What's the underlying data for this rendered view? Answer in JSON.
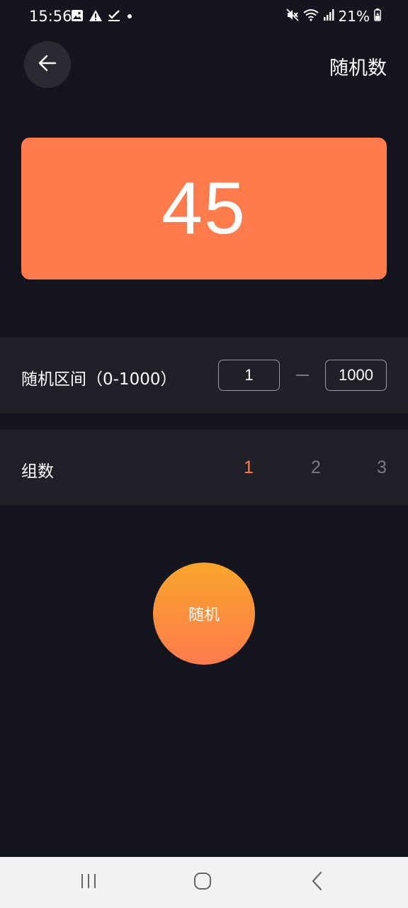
{
  "status_bar": {
    "time": "15:56",
    "battery_percent": "21%",
    "left_icons": [
      "image-icon",
      "warning-icon",
      "check-icon",
      "dot-icon"
    ],
    "right_icons": [
      "mute-icon",
      "wifi-icon",
      "signal-icon",
      "battery-charging-icon"
    ]
  },
  "header": {
    "back_icon": "arrow-left-icon",
    "title": "随机数"
  },
  "result": {
    "value": "45",
    "color": "#ff7b4c"
  },
  "range": {
    "label": "随机区间（0-1000）",
    "min_value": "1",
    "max_value": "1000"
  },
  "groups": {
    "label": "组数",
    "options": [
      "1",
      "2",
      "3"
    ],
    "selected": "1"
  },
  "action": {
    "button_label": "随机",
    "gradient_colors": [
      "#f9a52c",
      "#ff7b4c"
    ]
  },
  "nav_bar": {
    "icons": [
      "recents-icon",
      "home-icon",
      "back-icon"
    ]
  },
  "colors": {
    "background": "#15151f",
    "row_background": "#202029",
    "accent": "#ff7b4c",
    "inactive_text": "#7a7a84"
  }
}
